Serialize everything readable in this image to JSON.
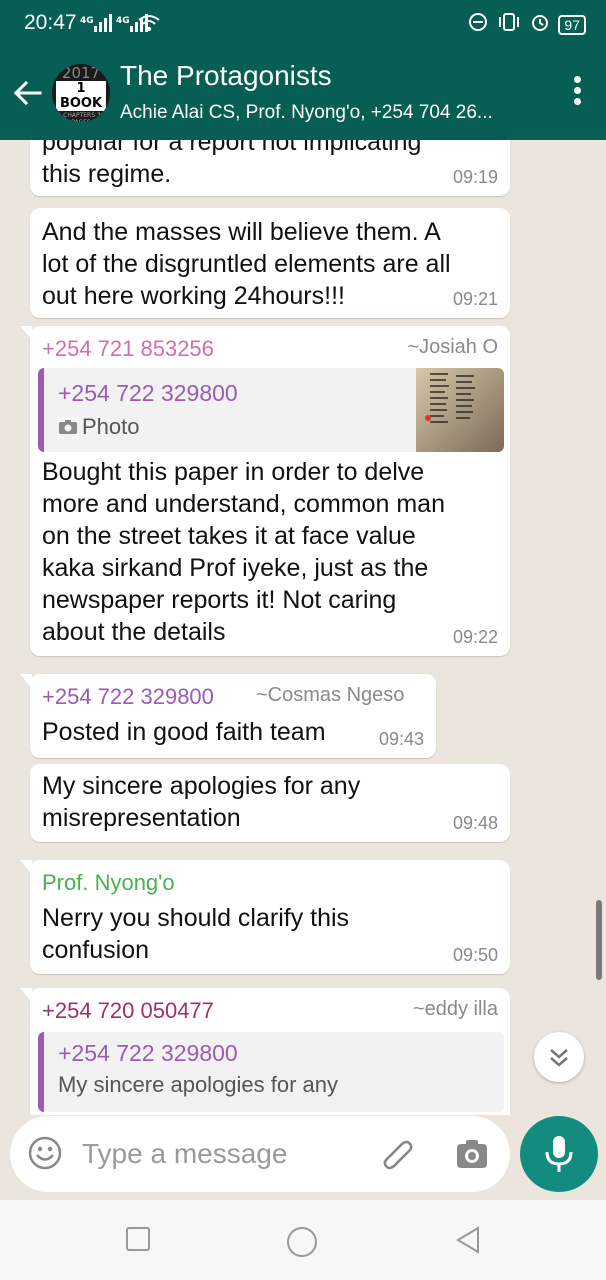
{
  "status": {
    "time": "20:47",
    "sig1": "4G",
    "sig2": "4G",
    "battery": "97"
  },
  "header": {
    "title": "The Protagonists",
    "subtitle": "Achie Alai CS, Prof. Nyong'o, +254 704 26...",
    "avatar_year": "2017",
    "avatar_book": "1 BOOK",
    "avatar_small": "52 CHAPTERS 365 PAGES"
  },
  "messages": [
    {
      "text1": "popular for a report not implicating",
      "text2": "this regime.",
      "time": "09:19"
    },
    {
      "lines": [
        "And the masses will believe them. A",
        "lot of the disgruntled elements are all",
        "out here working 24hours!!!"
      ],
      "time": "09:21"
    },
    {
      "sender": "+254 721 853256",
      "alias": "~Josiah O",
      "quote_sender": "+254 722 329800",
      "quote_text": "Photo",
      "lines": [
        "Bought this paper in order to delve",
        "more and understand, common man",
        "on the street takes it at face value",
        "kaka sirkand Prof iyeke, just as the",
        "newspaper reports it! Not caring",
        "about the details"
      ],
      "time": "09:22"
    },
    {
      "sender": "+254 722 329800",
      "alias": "~Cosmas Ngeso",
      "text": "Posted in good faith team",
      "time": "09:43"
    },
    {
      "lines": [
        "My sincere apologies for any",
        "misrepresentation"
      ],
      "time": "09:48"
    },
    {
      "sender": "Prof. Nyong'o",
      "lines": [
        "Nerry you should clarify this",
        "confusion"
      ],
      "time": "09:50"
    },
    {
      "sender": "+254 720 050477",
      "alias": "~eddy illa",
      "quote_sender": "+254 722 329800",
      "quote_text": "My sincere apologies for any"
    }
  ],
  "input": {
    "placeholder": "Type a message"
  },
  "colors": {
    "header": "#075e54",
    "mic": "#128c7e",
    "sender1": "#d36fa8",
    "sender2": "#9c5bb3",
    "sender3": "#4caf50",
    "sender4": "#a0306b"
  },
  "icons": [
    "back-arrow-icon",
    "more-vert-icon",
    "emoji-icon",
    "attach-icon",
    "camera-icon",
    "mic-icon",
    "chevron-down-icon",
    "nav-recents-icon",
    "nav-home-icon",
    "nav-back-icon"
  ]
}
